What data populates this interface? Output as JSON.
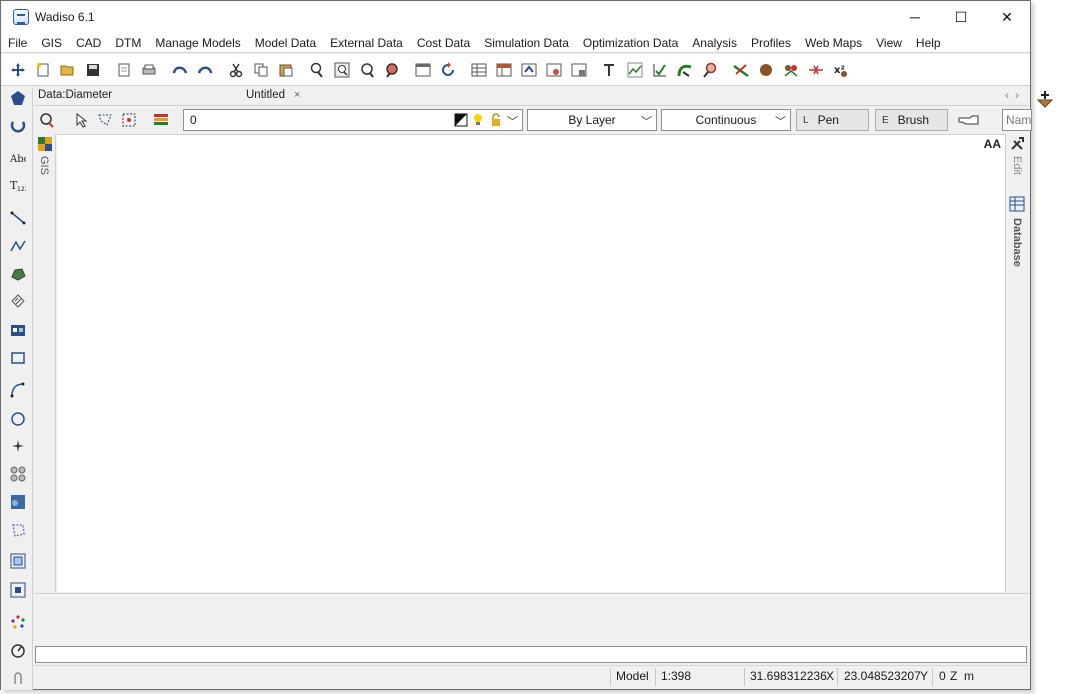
{
  "window": {
    "title": "Wadiso 6.1",
    "min_glyph": "─",
    "max_glyph": "☐",
    "close_glyph": "✕"
  },
  "menu": [
    "File",
    "GIS",
    "CAD",
    "DTM",
    "Manage Models",
    "Model Data",
    "External Data",
    "Cost Data",
    "Simulation Data",
    "Optimization Data",
    "Analysis",
    "Profiles",
    "Web Maps",
    "View",
    "Help"
  ],
  "tabs": {
    "data_tab": "Data:Diameter",
    "untitled_tab": "Untitled",
    "close_glyph": "×",
    "nav_glyphs": "‹›"
  },
  "layerbar": {
    "layer_value": "0",
    "line_type": "By Layer",
    "line_style": "Continuous",
    "pen_key": "L",
    "pen_label": "Pen",
    "brush_key": "E",
    "brush_label": "Brush",
    "name_placeholder": "Nam"
  },
  "side": {
    "gis_label": "GIS",
    "edit_label": "Edit",
    "database_label": "Database",
    "canvas_font_glyph": "AA"
  },
  "status": {
    "mode": "Model",
    "scale": "1:398",
    "x_value": "31.698312236",
    "x_label": "X",
    "y_value": "23.048523207",
    "y_label": "Y",
    "z_value": "0",
    "z_label": "Z",
    "unit": "m"
  },
  "icons": {
    "toolbar": [
      "pan-icon",
      "new-icon",
      "open-icon",
      "save-icon",
      "print-preview-icon",
      "print-icon",
      "undo-icon",
      "redo-icon",
      "cut-icon",
      "copy-icon",
      "paste-icon",
      "zoom-window-icon",
      "zoom-icon",
      "zoom-extents-icon",
      "zoom-previous-icon",
      "view-icon",
      "refresh-icon",
      "table-icon",
      "table-edit-icon",
      "table-view-icon",
      "table-join-icon",
      "table-link-icon",
      "text-tool-icon",
      "graph-icon",
      "check-icon",
      "pipe-icon",
      "find-icon",
      "connect-icon",
      "node-icon",
      "multi-node-icon",
      "break-icon",
      "formula-icon"
    ],
    "left": [
      "select-icon",
      "rotate-icon",
      "text-icon",
      "text-number-icon",
      "line-icon",
      "polyline-icon",
      "polygon-icon",
      "hatch-icon",
      "block-icon",
      "rectangle-icon",
      "arc-icon",
      "circle-icon",
      "point-icon",
      "group-icon",
      "image-icon",
      "region-icon",
      "frame-icon",
      "extents-icon",
      "cluster-icon",
      "measure-icon",
      "snap-icon"
    ]
  }
}
